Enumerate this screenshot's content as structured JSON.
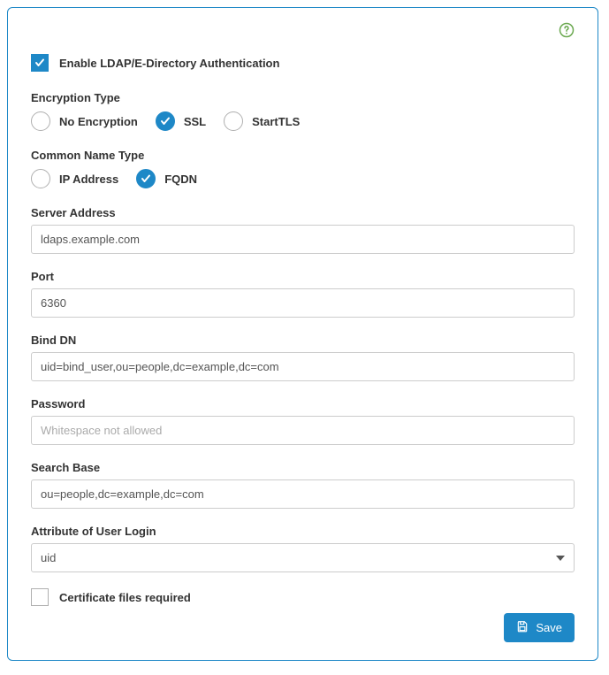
{
  "enable": {
    "checked": true,
    "label": "Enable LDAP/E-Directory Authentication"
  },
  "encryption": {
    "group_label": "Encryption Type",
    "options": [
      {
        "label": "No Encryption",
        "checked": false
      },
      {
        "label": "SSL",
        "checked": true
      },
      {
        "label": "StartTLS",
        "checked": false
      }
    ]
  },
  "common_name": {
    "group_label": "Common Name Type",
    "options": [
      {
        "label": "IP Address",
        "checked": false
      },
      {
        "label": "FQDN",
        "checked": true
      }
    ]
  },
  "server_address": {
    "label": "Server Address",
    "value": "ldaps.example.com"
  },
  "port": {
    "label": "Port",
    "value": "6360"
  },
  "bind_dn": {
    "label": "Bind DN",
    "value": "uid=bind_user,ou=people,dc=example,dc=com"
  },
  "password": {
    "label": "Password",
    "placeholder": "Whitespace not allowed",
    "value": ""
  },
  "search_base": {
    "label": "Search Base",
    "value": "ou=people,dc=example,dc=com"
  },
  "attribute": {
    "label": "Attribute of User Login",
    "selected": "uid"
  },
  "cert_files": {
    "checked": false,
    "label": "Certificate files required"
  },
  "save_button": {
    "label": "Save"
  }
}
